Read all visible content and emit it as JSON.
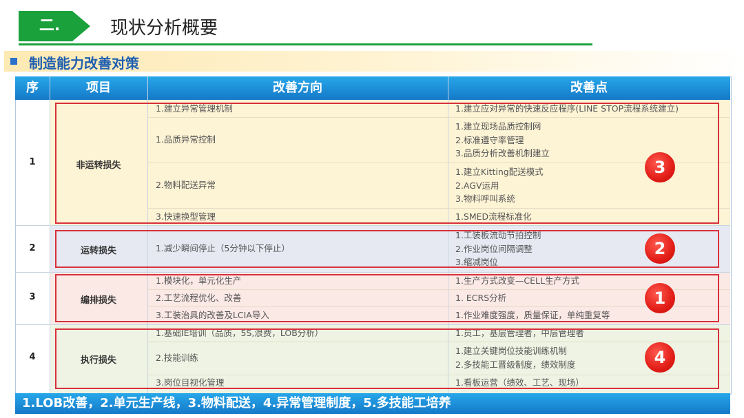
{
  "header": {
    "section_number": "二.",
    "title": "现状分析概要"
  },
  "section": {
    "title": "制造能力改善对策"
  },
  "table": {
    "columns": [
      "序",
      "项目",
      "改善方向",
      "改善点"
    ],
    "rows": [
      {
        "seq": "1",
        "item": "非运转损失",
        "badge": "3",
        "subrows": [
          {
            "direction": "1.建立异常管理机制",
            "points": [
              "1.建立应对异常的快速反应程序(LINE  STOP流程系统建立)"
            ]
          },
          {
            "direction": "1.品质异常控制",
            "points": [
              "1.建立现场品质控制网",
              "2.标准遵守率管理",
              "3.品质分析改善机制建立"
            ]
          },
          {
            "direction": "2.物料配送异常",
            "points": [
              "1.建立Kitting配送模式",
              "2.AGV运用",
              "3.物料呼叫系统"
            ]
          },
          {
            "direction": "3.快速换型管理",
            "points": [
              "1.SMED流程标准化"
            ]
          }
        ]
      },
      {
        "seq": "2",
        "item": "运转损失",
        "badge": "2",
        "subrows": [
          {
            "direction": "1.减少瞬间停止（5分钟以下停止）",
            "points": [
              "1.工装板流动节拍控制",
              "2.作业岗位间隔调整",
              "3.缩减岗位"
            ]
          }
        ]
      },
      {
        "seq": "3",
        "item": "编排损失",
        "badge": "1",
        "subrows": [
          {
            "direction": "1.模块化，单元化生产",
            "points": [
              "1.生产方式改变—CELL生产方式"
            ]
          },
          {
            "direction": "2.工艺流程优化、改善",
            "points": [
              "1. ECRS分析"
            ]
          },
          {
            "direction": "3.工装治具的改善及LCIA导入",
            "points": [
              "1.作业难度强度，质量保证，单纯重复等"
            ]
          }
        ]
      },
      {
        "seq": "4",
        "item": "执行损失",
        "badge": "4",
        "subrows": [
          {
            "direction": "1.基础IE培训（品质，5S,浪费，LOB分析）",
            "points": [
              "1.员工，基层管理者，中层管理者"
            ]
          },
          {
            "direction": "2.技能训练",
            "points": [
              "1.建立关键岗位技能训练机制",
              "2.多技能工晋级制度，绩效制度"
            ]
          },
          {
            "direction": "3.岗位目视化管理",
            "points": [
              "1.看板运营（绩效、工艺、现场）"
            ]
          }
        ]
      }
    ]
  },
  "footer": {
    "summary": "1.LOB改善，2.单元生产线，3.物料配送，4.异常管理制度，5.多技能工培养"
  },
  "colors": {
    "green": "#1aa13b",
    "blue_header": "#1b8fdc",
    "red_box": "#d8303a",
    "band_row1": "#fdf3d5",
    "band_row2": "#e6e9f2",
    "band_row3": "#fbe9e6",
    "band_row4": "#eef3e3"
  }
}
